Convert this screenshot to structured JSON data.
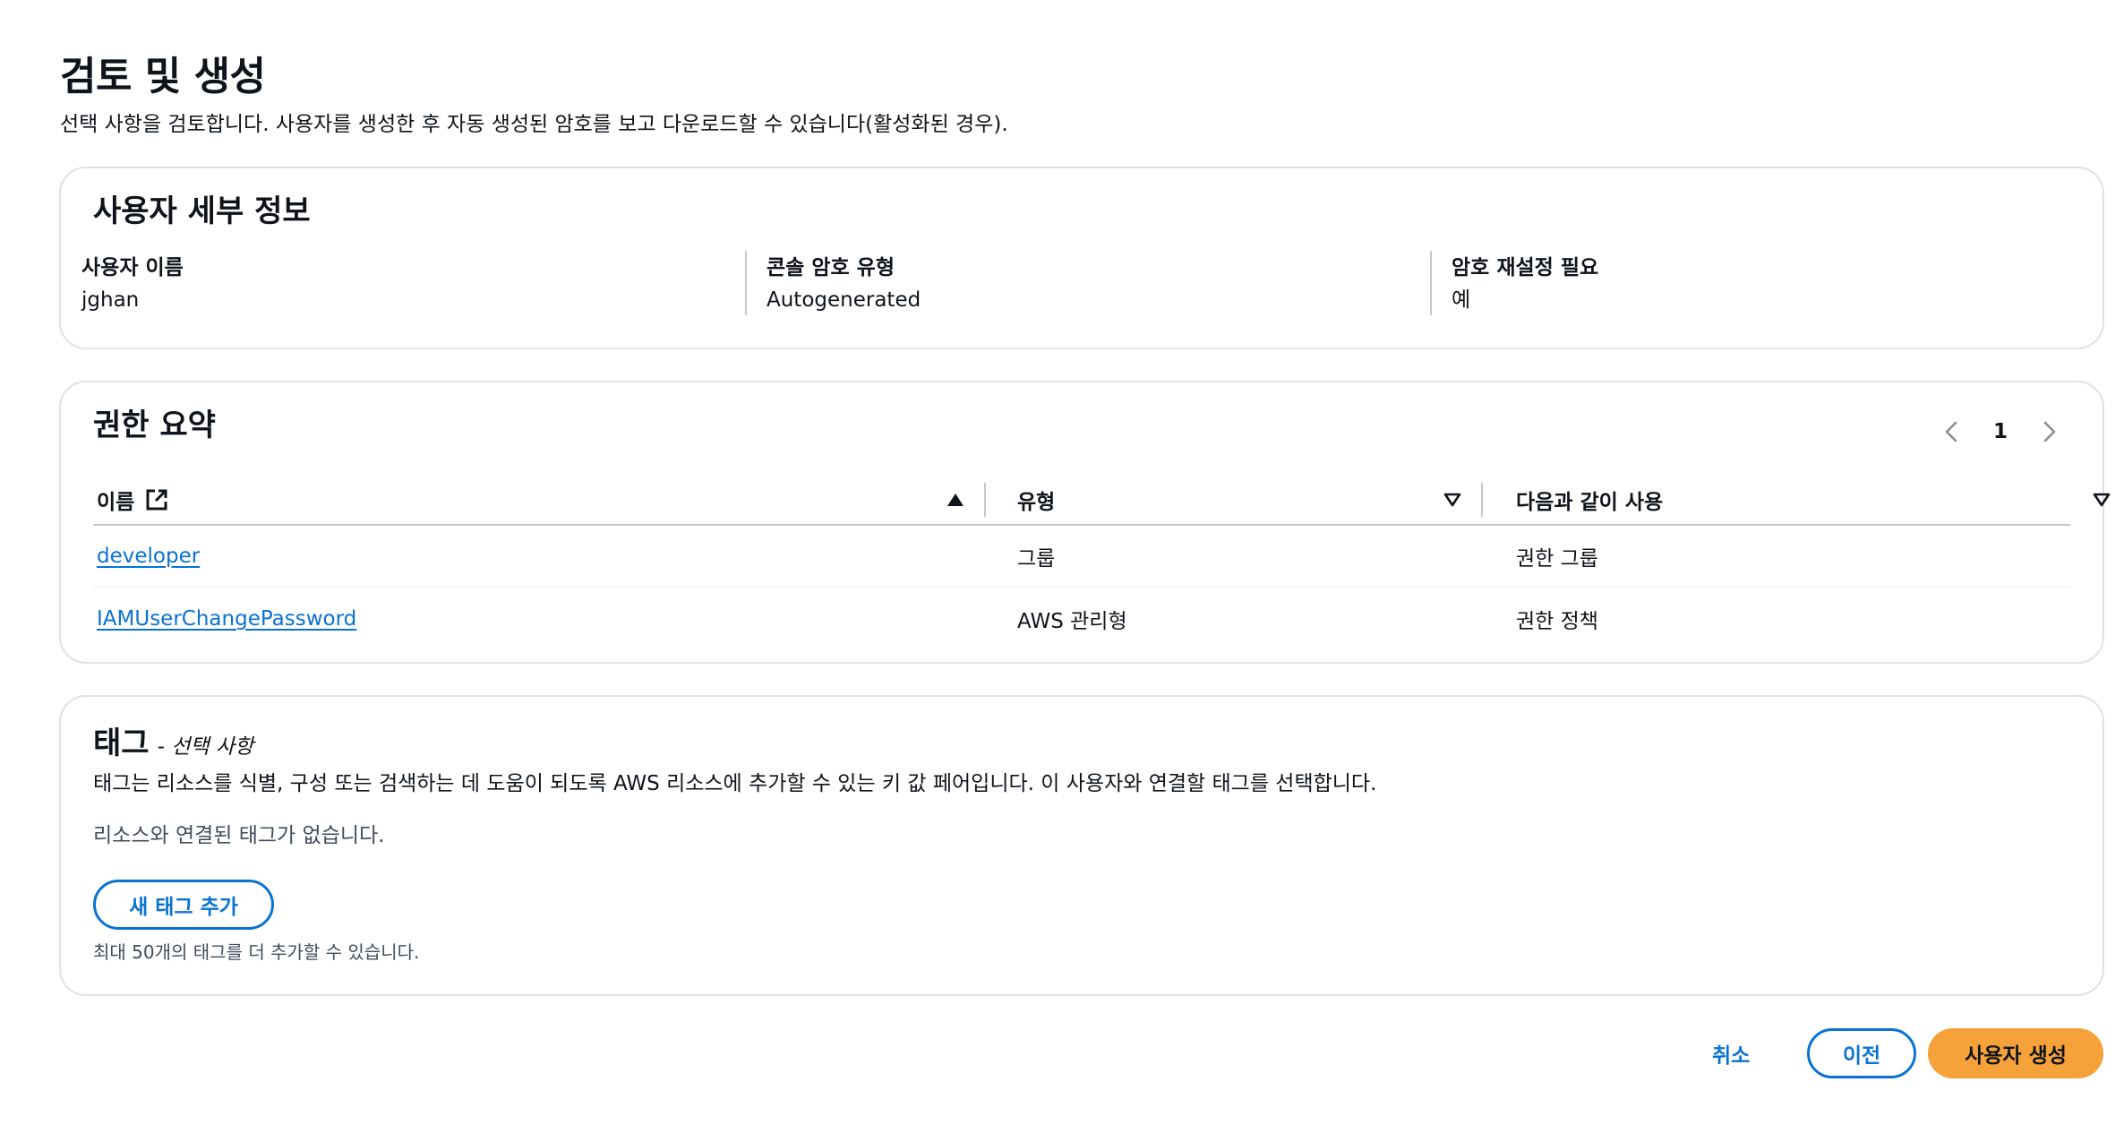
{
  "header": {
    "title": "검토 및 생성",
    "description": "선택 사항을 검토합니다. 사용자를 생성한 후 자동 생성된 암호를 보고 다운로드할 수 있습니다(활성화된 경우)."
  },
  "user_details": {
    "title": "사용자 세부 정보",
    "fields": [
      {
        "label": "사용자 이름",
        "value": "jghan"
      },
      {
        "label": "콘솔 암호 유형",
        "value": "Autogenerated"
      },
      {
        "label": "암호 재설정 필요",
        "value": "예"
      }
    ]
  },
  "permissions": {
    "title": "권한 요약",
    "pagination": {
      "current_page": "1",
      "prev_icon": "chevron-left-icon",
      "next_icon": "chevron-right-icon"
    },
    "columns": [
      {
        "label": "이름",
        "icon": "external-link-icon",
        "sort": "ascending"
      },
      {
        "label": "유형",
        "sort": "none"
      },
      {
        "label": "다음과 같이 사용",
        "sort": "none"
      }
    ],
    "rows": [
      {
        "name": "developer",
        "type": "그룹",
        "used_as": "권한 그룹"
      },
      {
        "name": "IAMUserChangePassword",
        "type": "AWS 관리형",
        "used_as": "권한 정책"
      }
    ]
  },
  "tags": {
    "title": "태그",
    "optional_label": "- 선택 사항",
    "description": "태그는 리소스를 식별, 구성 또는 검색하는 데 도움이 되도록 AWS 리소스에 추가할 수 있는 키 값 페어입니다. 이 사용자와 연결할 태그를 선택합니다.",
    "empty_text": "리소스와 연결된 태그가 없습니다.",
    "add_button": "새 태그 추가",
    "hint": "최대 50개의 태그를 더 추가할 수 있습니다."
  },
  "actions": {
    "cancel": "취소",
    "previous": "이전",
    "create": "사용자 생성"
  },
  "colors": {
    "link": "#0972d3",
    "primary_button": "#f6a23a",
    "border": "#dee2e6"
  }
}
